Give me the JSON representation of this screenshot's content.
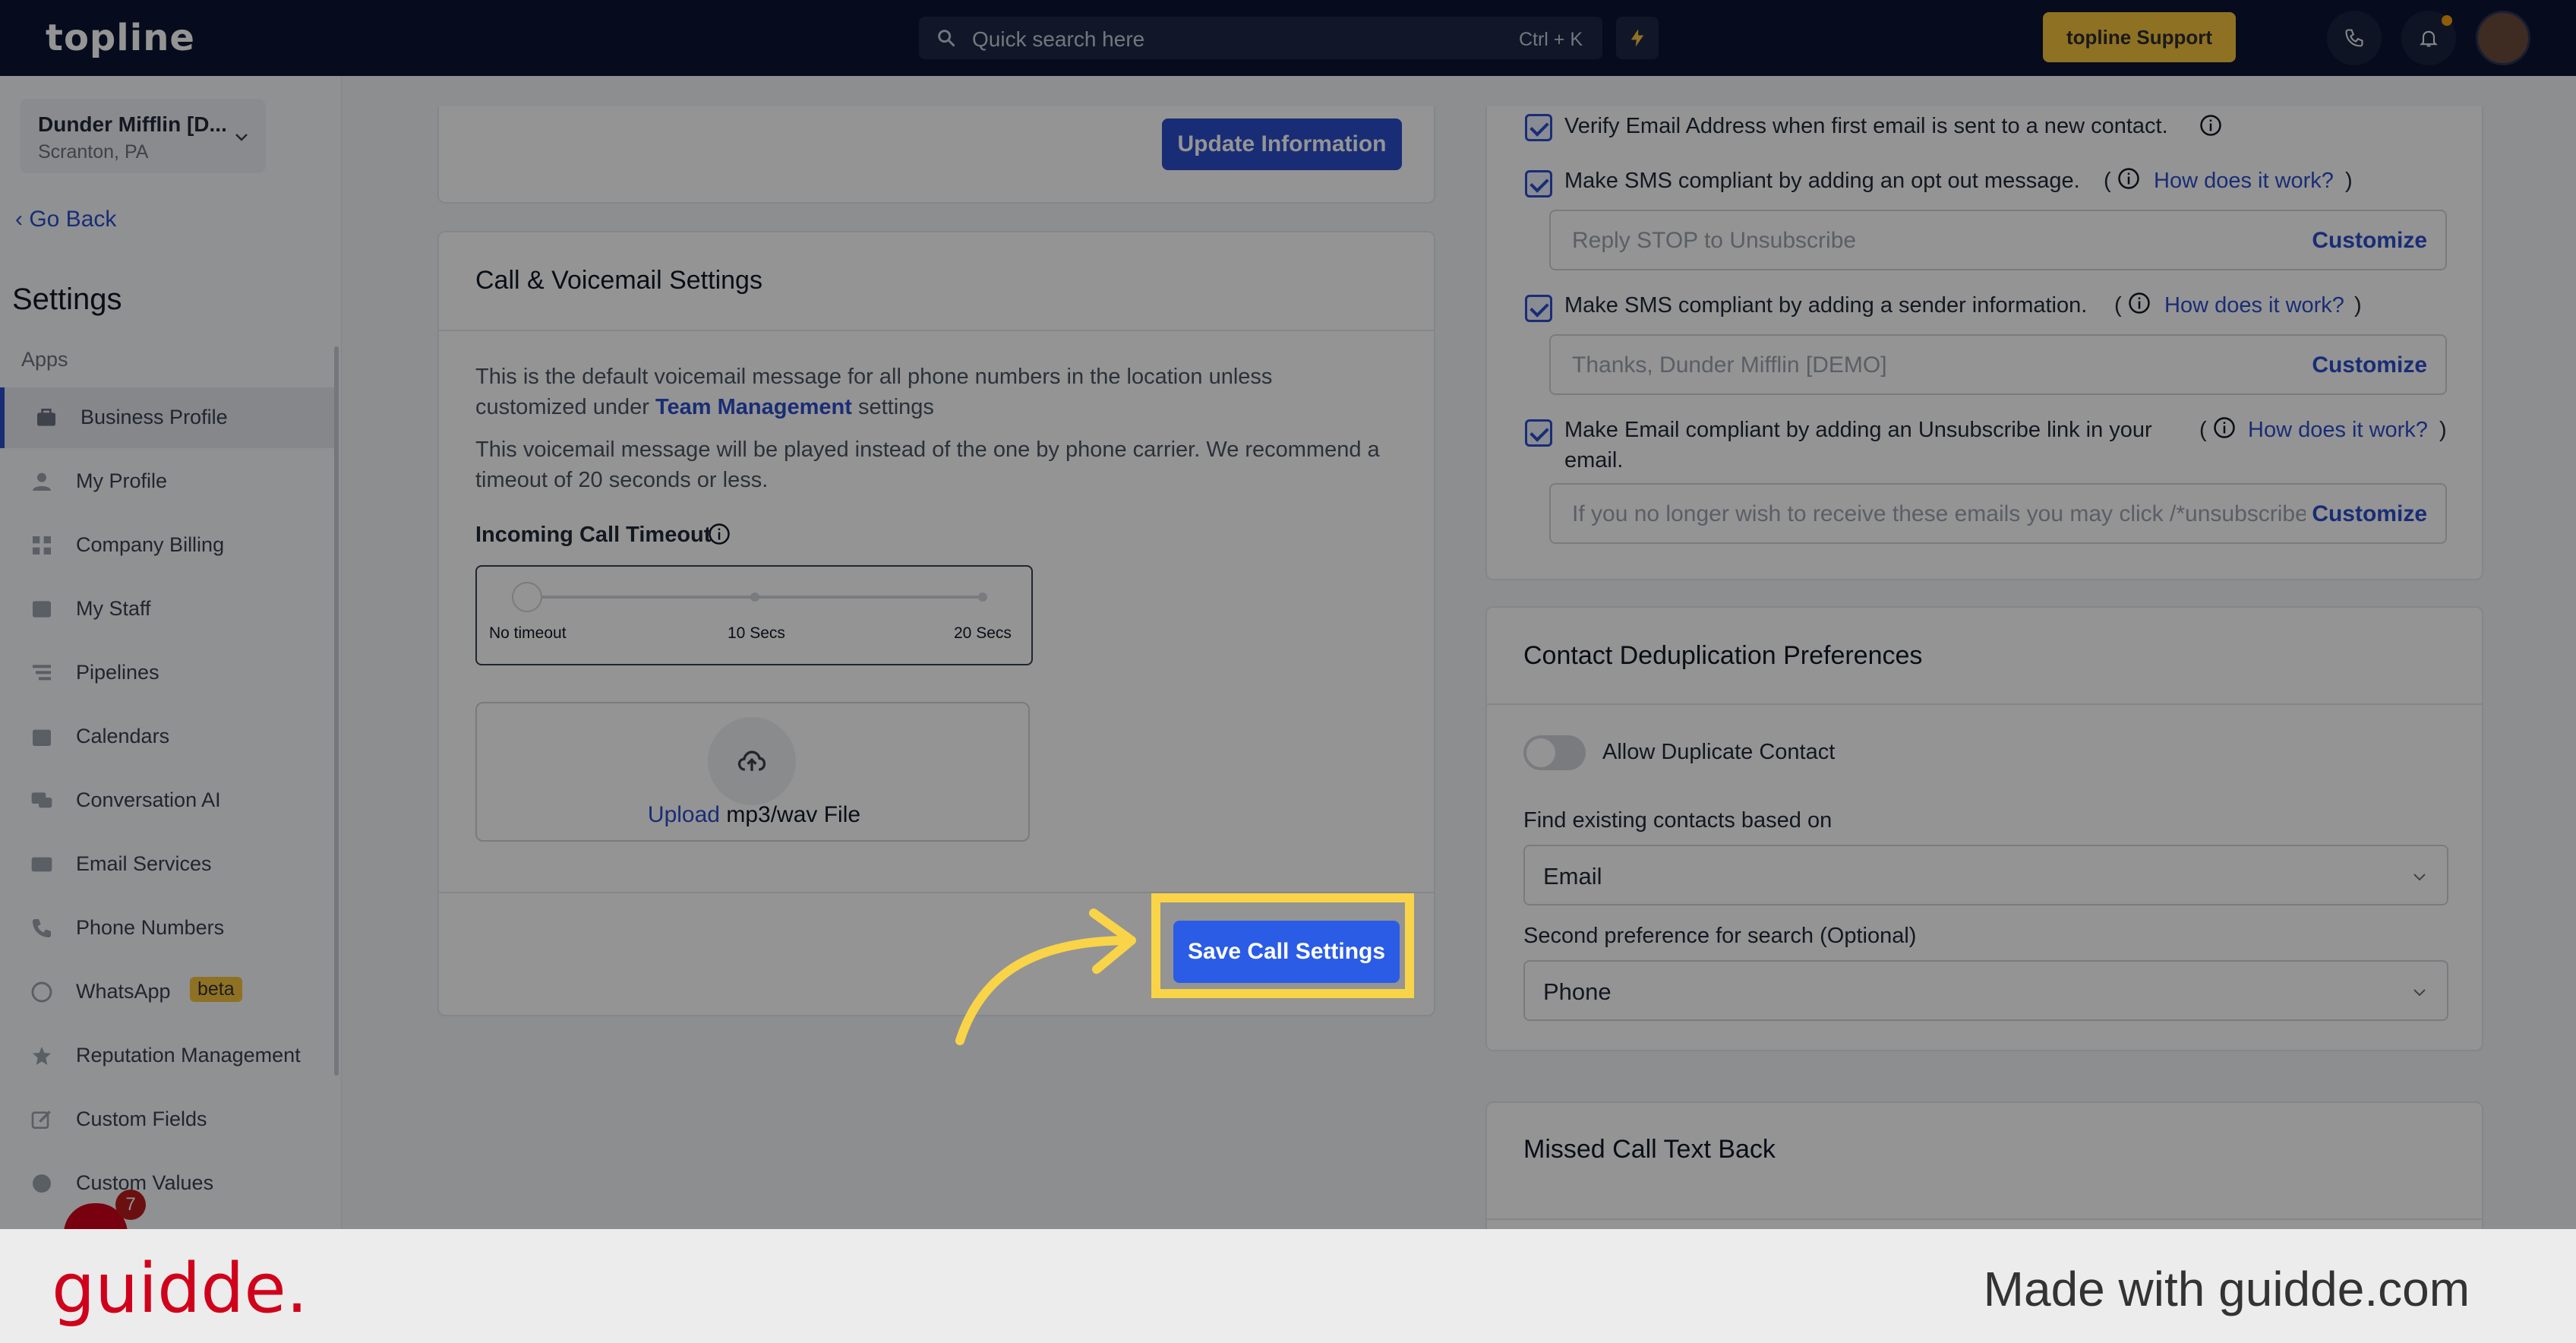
{
  "topbar": {
    "logo": "topline",
    "search_placeholder": "Quick search here",
    "search_shortcut": "Ctrl + K",
    "support_label": "topline Support"
  },
  "sidebar": {
    "location_name": "Dunder Mifflin [D...",
    "location_sub": "Scranton, PA",
    "go_back": "Go Back",
    "heading": "Settings",
    "section": "Apps",
    "items": [
      {
        "label": "Business Profile",
        "icon": "briefcase-icon",
        "active": true
      },
      {
        "label": "My Profile",
        "icon": "user-icon"
      },
      {
        "label": "Company Billing",
        "icon": "grid-icon"
      },
      {
        "label": "My Staff",
        "icon": "inbox-icon"
      },
      {
        "label": "Pipelines",
        "icon": "filter-icon"
      },
      {
        "label": "Calendars",
        "icon": "calendar-icon"
      },
      {
        "label": "Conversation AI",
        "icon": "chat-icon"
      },
      {
        "label": "Email Services",
        "icon": "mail-icon"
      },
      {
        "label": "Phone Numbers",
        "icon": "phone-icon"
      },
      {
        "label": "WhatsApp",
        "icon": "whatsapp-icon",
        "badge": "beta"
      },
      {
        "label": "Reputation Management",
        "icon": "star-icon"
      },
      {
        "label": "Custom Fields",
        "icon": "edit-icon"
      },
      {
        "label": "Custom Values",
        "icon": "pie-icon"
      }
    ],
    "notification_count": "7"
  },
  "left": {
    "update_button": "Update Information",
    "call_title": "Call & Voicemail Settings",
    "para1_a": "This is the default voicemail message for all phone numbers in the location unless customized under ",
    "para1_link": "Team Management",
    "para1_b": " settings",
    "para2": "This voicemail message will be played instead of the one by phone carrier. We recommend a timeout of 20 seconds or less.",
    "timeout_label": "Incoming Call Timeout",
    "slider_labels": [
      "No timeout",
      "10 Secs",
      "20 Secs"
    ],
    "slider_value": 0,
    "upload_link": "Upload",
    "upload_text": " mp3/wav File",
    "save_button": "Save Call Settings"
  },
  "right": {
    "verify_email": "Verify Email Address when first email is sent to a new contact.",
    "sms_optout": "Make SMS compliant by adding an opt out message.",
    "how": "How does it work?",
    "optout_value": "Reply STOP to Unsubscribe",
    "customize": "Customize",
    "sms_sender": "Make SMS compliant by adding a sender information.",
    "sender_value": "Thanks, Dunder Mifflin [DEMO]",
    "email_unsub_1": "Make Email compliant by adding an Unsubscribe link in your",
    "email_unsub_2": "email.",
    "unsub_value": "If you no longer wish to receive these emails you may click /*unsubscribe*/",
    "dedup_title": "Contact Deduplication Preferences",
    "allow_duplicate": "Allow Duplicate Contact",
    "find_label": "Find existing contacts based on",
    "find_value": "Email",
    "second_label": "Second preference for search (Optional)",
    "second_value": "Phone",
    "missed_title": "Missed Call Text Back"
  },
  "footer": {
    "brand": "guidde.",
    "made_with": "Made with guidde.com"
  },
  "colors": {
    "primary": "#2b4ecb",
    "highlight": "#f9d448",
    "topbar": "#0b1533"
  }
}
